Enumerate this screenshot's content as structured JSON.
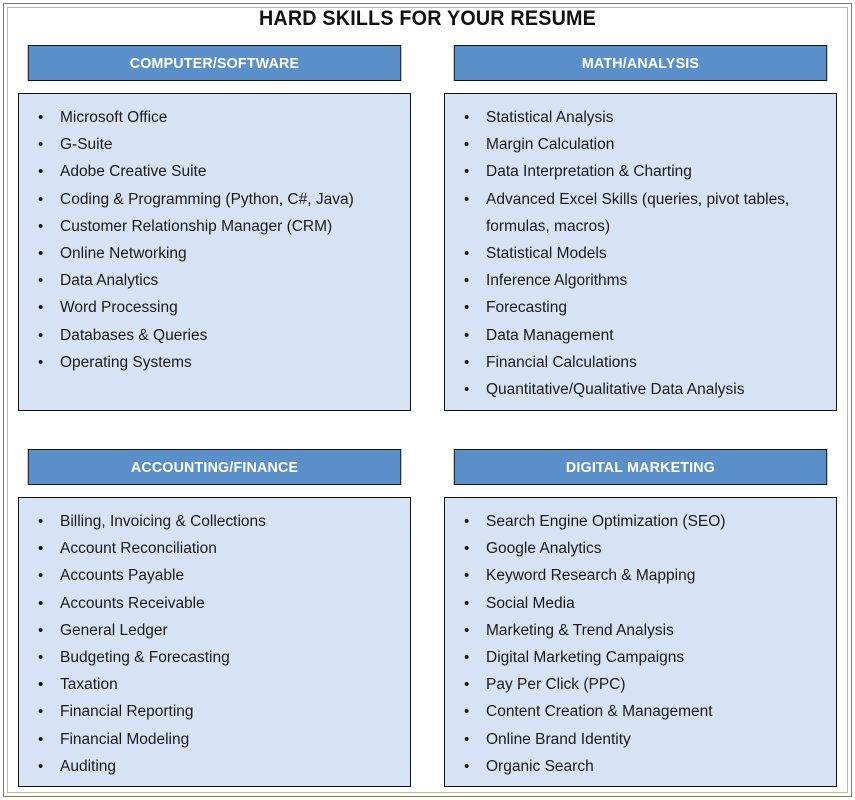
{
  "page": {
    "title": "HARD SKILLS FOR YOUR RESUME",
    "accent_color": "#5B8FC9",
    "body_fill_color": "#D6E3F5",
    "border_color": "#111111",
    "frame_color": "#7D7F5E",
    "bullet_glyph": "•"
  },
  "quadrants": [
    {
      "id": "computer-software",
      "header": "COMPUTER/SOFTWARE",
      "skills": [
        "Microsoft Office",
        "G-Suite",
        "Adobe Creative Suite",
        "Coding & Programming (Python, C#, Java)",
        "Customer Relationship Manager (CRM)",
        "Online Networking",
        "Data Analytics",
        "Word Processing",
        "Databases & Queries",
        "Operating Systems"
      ]
    },
    {
      "id": "math-analysis",
      "header": "MATH/ANALYSIS",
      "skills": [
        "Statistical Analysis",
        "Margin Calculation",
        "Data Interpretation & Charting",
        "Advanced Excel Skills (queries, pivot tables, formulas, macros)",
        "Statistical Models",
        "Inference Algorithms",
        "Forecasting",
        "Data Management",
        "Financial Calculations",
        "Quantitative/Qualitative Data Analysis"
      ]
    },
    {
      "id": "accounting-finance",
      "header": "ACCOUNTING/FINANCE",
      "skills": [
        "Billing, Invoicing & Collections",
        "Account Reconciliation",
        "Accounts Payable",
        "Accounts Receivable",
        "General Ledger",
        "Budgeting & Forecasting",
        "Taxation",
        "Financial Reporting",
        "Financial Modeling",
        "Auditing"
      ]
    },
    {
      "id": "digital-marketing",
      "header": "DIGITAL MARKETING",
      "skills": [
        "Search Engine Optimization (SEO)",
        "Google Analytics",
        "Keyword Research & Mapping",
        "Social Media",
        "Marketing & Trend Analysis",
        "Digital Marketing Campaigns",
        "Pay Per Click (PPC)",
        "Content Creation & Management",
        "Online Brand Identity",
        "Organic Search"
      ]
    }
  ]
}
